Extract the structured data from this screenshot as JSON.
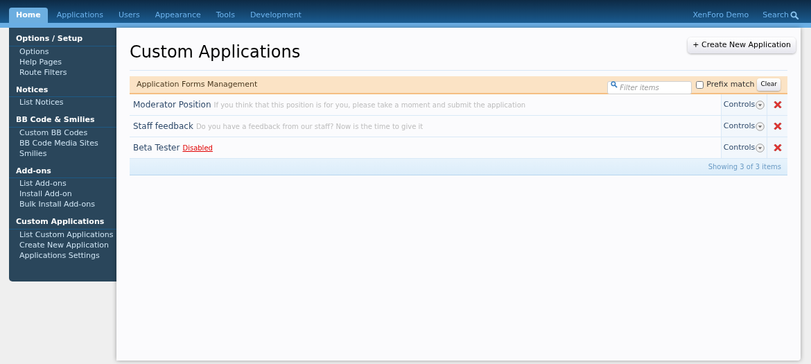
{
  "nav_tabs": [
    {
      "label": "Home",
      "selected": true
    },
    {
      "label": "Applications",
      "selected": false
    },
    {
      "label": "Users",
      "selected": false
    },
    {
      "label": "Appearance",
      "selected": false
    },
    {
      "label": "Tools",
      "selected": false
    },
    {
      "label": "Development",
      "selected": false
    }
  ],
  "nav_right": {
    "site_link": "XenForo Demo",
    "search": "Search"
  },
  "sidebar": {
    "sections": [
      {
        "title": "Options / Setup",
        "items": [
          "Options",
          "Help Pages",
          "Route Filters"
        ]
      },
      {
        "title": "Notices",
        "items": [
          "List Notices"
        ]
      },
      {
        "title": "BB Code & Smilies",
        "items": [
          "Custom BB Codes",
          "BB Code Media Sites",
          "Smilies"
        ]
      },
      {
        "title": "Add-ons",
        "items": [
          "List Add-ons",
          "Install Add-on",
          "Bulk Install Add-ons"
        ]
      },
      {
        "title": "Custom Applications",
        "items": [
          "List Custom Applications",
          "Create New Application",
          "Applications Settings"
        ]
      }
    ]
  },
  "page": {
    "title": "Custom Applications",
    "create_button": "+ Create New Application"
  },
  "list": {
    "heading": "Application Forms Management",
    "filter_placeholder": "Filter items",
    "prefix_match": {
      "label": "Prefix match",
      "checked": false
    },
    "clear_button": "Clear",
    "rows": [
      {
        "name": "Moderator Position",
        "note": "If you think that this position is for you, please take a moment and submit the application",
        "disabled": false,
        "controls": "Controls"
      },
      {
        "name": "Staff feedback",
        "note": "Do you have a feedback from our staff? Now is the time to give it",
        "disabled": false,
        "controls": "Controls"
      },
      {
        "name": "Beta Tester",
        "note": "Disabled",
        "disabled": true,
        "controls": "Controls"
      }
    ],
    "footer": "Showing 3 of 3 items"
  }
}
